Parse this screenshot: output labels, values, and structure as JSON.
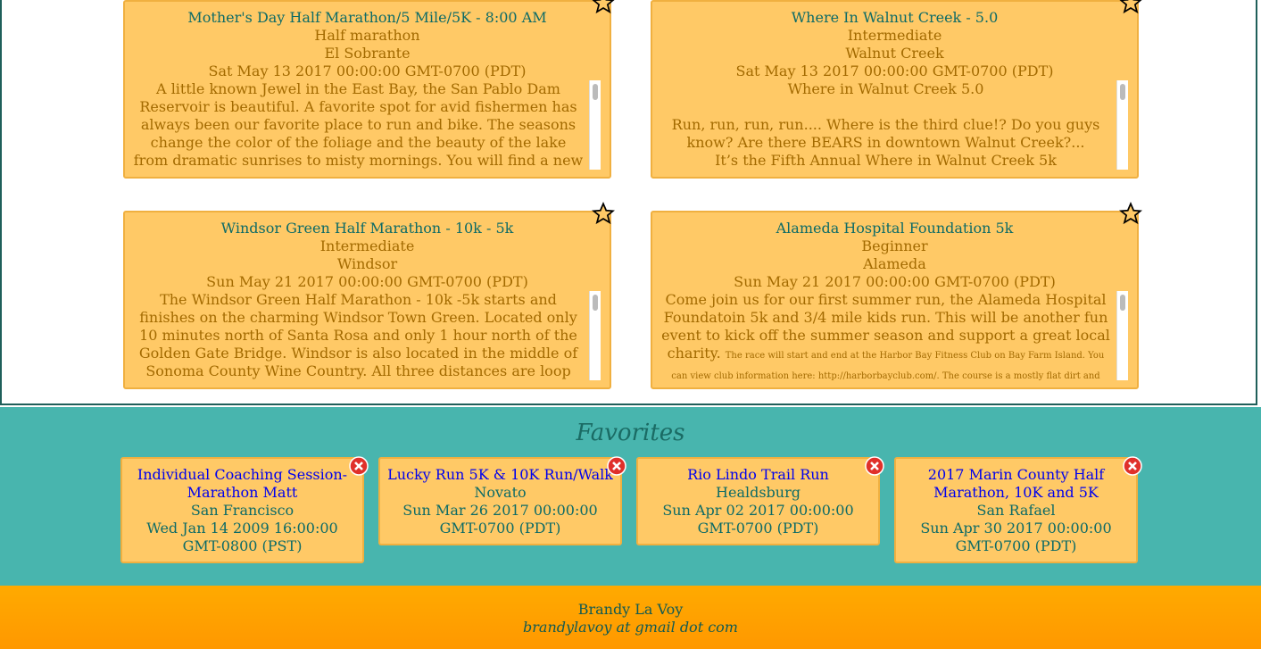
{
  "events": [
    {
      "title": "Mother's Day Half Marathon/5 Mile/5K - 8:00 AM",
      "level": "Half marathon",
      "city": "El Sobrante",
      "date": "Sat May 13 2017 00:00:00 GMT-0700 (PDT)",
      "description": "A little known Jewel in the East Bay, the San Pablo Dam Reservoir is beautiful. A favorite spot for avid fishermen has always been our favorite place to run and bike. The seasons change the color of the foliage and the beauty of the lake from dramatic sunrises to misty mornings. You will find a new place"
    },
    {
      "title": "Where In Walnut Creek - 5.0",
      "level": "Intermediate",
      "city": "Walnut Creek",
      "date": "Sat May 13 2017 00:00:00 GMT-0700 (PDT)",
      "description": "Where in Walnut Creek 5.0",
      "description2": "Run, run, run, run.... Where is the third clue!? Do you guys know?  Are there BEARS in downtown Walnut Creek?...",
      "description3": "It’s the Fifth Annual Where in Walnut Creek 5k"
    },
    {
      "title": "Windsor Green Half Marathon - 10k - 5k",
      "level": "Intermediate",
      "city": "Windsor",
      "date": "Sun May 21 2017 00:00:00 GMT-0700 (PDT)",
      "description": "The Windsor Green Half Marathon - 10k -5k starts and finishes on the charming Windsor Town Green. Located only 10 minutes north of Santa Rosa and only 1 hour north of the Golden Gate Bridge. Windsor is also located in the middle of Sonoma County Wine Country. All three distances are loop courses running past"
    },
    {
      "title": "Alameda Hospital Foundation 5k",
      "level": "Beginner",
      "city": "Alameda",
      "date": "Sun May 21 2017 00:00:00 GMT-0700 (PDT)",
      "description": "Come join us for our first summer run, the Alameda Hospital Foundatoin 5k and 3/4 mile kids run. This will be another fun event to kick off the summer season and support a great local charity.",
      "description_small": "The race will start and end at the Harbor Bay Fitness Club on Bay Farm Island. You can view club information here: http://harborbayclub.com/. The course is a mostly flat dirt and paved trail"
    }
  ],
  "favorites_heading": "Favorites",
  "favorites": [
    {
      "name": "Individual Coaching Session- Marathon Matt",
      "city": "San Francisco",
      "date": "Wed Jan 14 2009 16:00:00 GMT-0800 (PST)"
    },
    {
      "name": "Lucky Run 5K & 10K Run/Walk",
      "city": "Novato",
      "date": "Sun Mar 26 2017 00:00:00 GMT-0700 (PDT)"
    },
    {
      "name": "Rio Lindo Trail Run",
      "city": "Healdsburg",
      "date": "Sun Apr 02 2017 00:00:00 GMT-0700 (PDT)"
    },
    {
      "name": "2017 Marin County Half Marathon, 10K and 5K",
      "city": "San Rafael",
      "date": "Sun Apr 30 2017 00:00:00 GMT-0700 (PDT)"
    }
  ],
  "footer": {
    "name": "Brandy La Voy",
    "email": "brandylavoy at gmail dot com"
  },
  "colors": {
    "card": "#ffc966",
    "favorites_bg": "#48b5ae",
    "footer_bg": "#ffaa00",
    "link": "#0000ee"
  }
}
